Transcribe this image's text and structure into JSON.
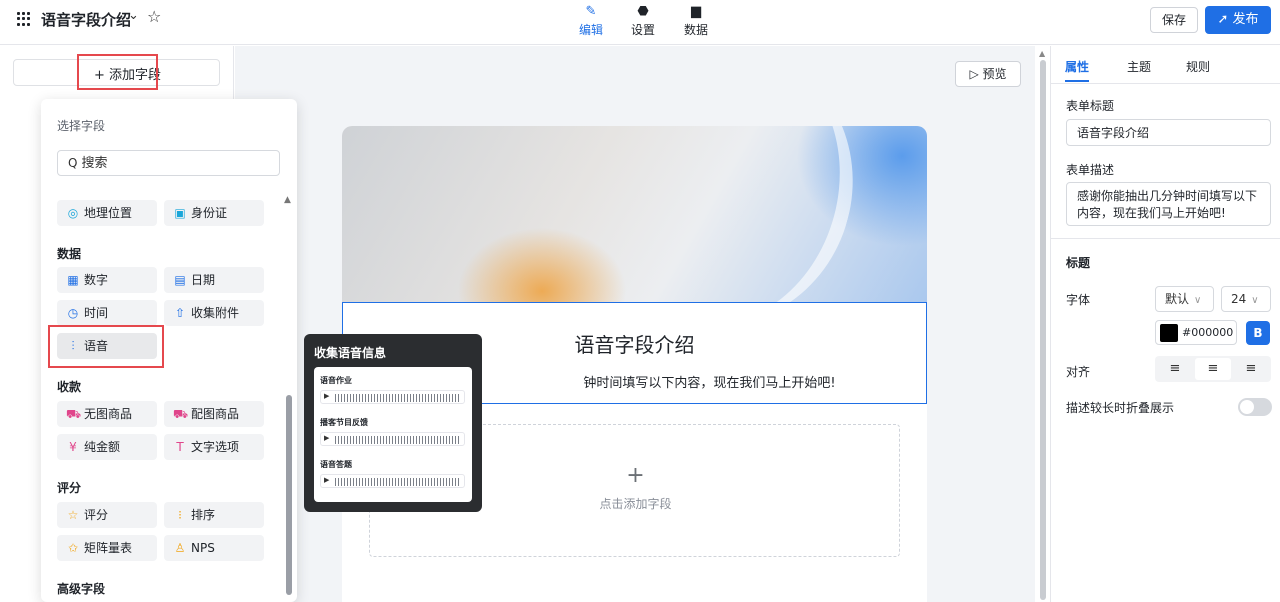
{
  "header": {
    "title": "语音字段介绍",
    "tabs": [
      {
        "label": "编辑",
        "icon": "pencil-icon"
      },
      {
        "label": "设置",
        "icon": "gear-icon"
      },
      {
        "label": "数据",
        "icon": "bar-chart-icon"
      }
    ],
    "save_label": "保存",
    "publish_label": "发布"
  },
  "left": {
    "add_field_label": "+ 添加字段"
  },
  "picker": {
    "title": "选择字段",
    "search_placeholder": "搜索",
    "top_items": [
      {
        "label": "地理位置",
        "icon": "location-icon"
      },
      {
        "label": "身份证",
        "icon": "id-card-icon"
      }
    ],
    "groups": [
      {
        "title": "数据",
        "items": [
          {
            "label": "数字",
            "icon": "number-icon"
          },
          {
            "label": "日期",
            "icon": "calendar-icon"
          },
          {
            "label": "时间",
            "icon": "clock-icon"
          },
          {
            "label": "收集附件",
            "icon": "upload-icon"
          },
          {
            "label": "语音",
            "icon": "audio-wave-icon"
          }
        ]
      },
      {
        "title": "收款",
        "items": [
          {
            "label": "无图商品",
            "icon": "cart-icon"
          },
          {
            "label": "配图商品",
            "icon": "image-cart-icon"
          },
          {
            "label": "纯金额",
            "icon": "yen-icon"
          },
          {
            "label": "文字选项",
            "icon": "text-option-icon"
          }
        ]
      },
      {
        "title": "评分",
        "items": [
          {
            "label": "评分",
            "icon": "star-icon"
          },
          {
            "label": "排序",
            "icon": "sort-icon"
          },
          {
            "label": "矩阵量表",
            "icon": "matrix-star-icon"
          },
          {
            "label": "NPS",
            "icon": "thumbs-up-icon"
          }
        ]
      },
      {
        "title": "高级字段",
        "items": []
      }
    ]
  },
  "tooltip": {
    "title": "收集语音信息",
    "samples": [
      "语音作业",
      "播客节目反馈",
      "语音答题"
    ]
  },
  "canvas": {
    "preview_label": "▷ 预览",
    "form_title": "语音字段介绍",
    "form_desc": "感谢你能抽出几分钟时间填写以下内容，现在我们马上开始吧!",
    "form_desc_visible": "钟时间填写以下内容，现在我们马上开始吧!",
    "add_zone_label": "点击添加字段"
  },
  "right": {
    "tabs": [
      "属性",
      "主题",
      "规则"
    ],
    "form_title_label": "表单标题",
    "form_title_value": "语音字段介绍",
    "form_desc_label": "表单描述",
    "form_desc_value": "感谢你能抽出几分钟时间填写以下内容，现在我们马上开始吧!",
    "heading_label": "标题",
    "font_label": "字体",
    "font_value": "默认",
    "size_value": "24",
    "color_value": "#000000",
    "bold_label": "B",
    "align_label": "对齐",
    "collapse_label": "描述较长时折叠展示"
  },
  "colors": {
    "accent": "#1f6fe5",
    "highlight": "#e5484d"
  }
}
